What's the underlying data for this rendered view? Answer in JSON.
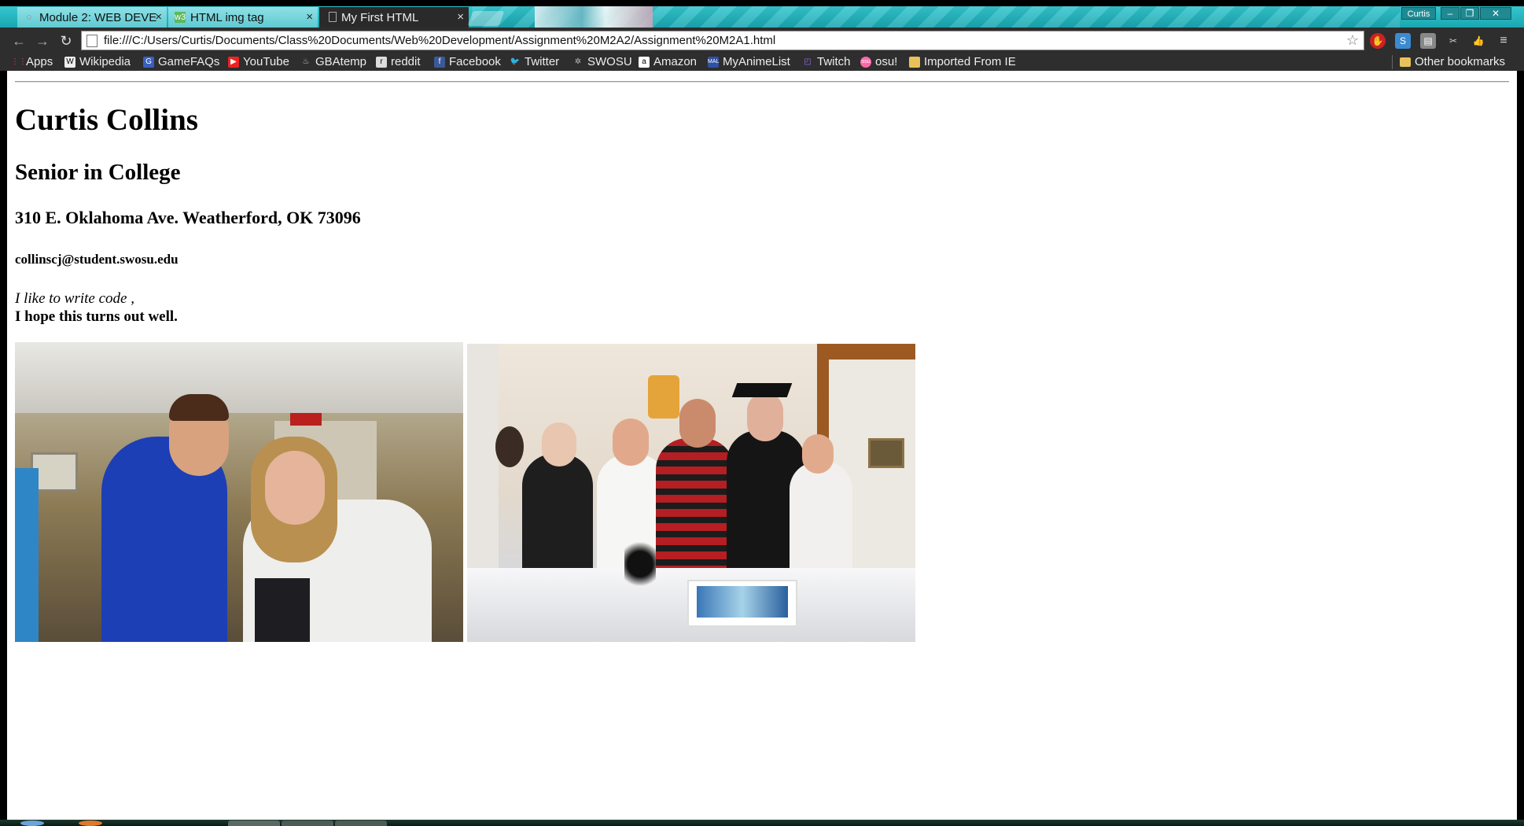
{
  "tabs": [
    {
      "label": "Module 2: WEB DEVE",
      "state": "inactive",
      "icon": "spinner-icon"
    },
    {
      "label": "HTML img tag",
      "state": "inactive",
      "icon": "w3schools-icon"
    },
    {
      "label": "My First HTML",
      "state": "active",
      "icon": "page-icon"
    }
  ],
  "window": {
    "user": "Curtis"
  },
  "toolbar": {
    "url": "file:///C:/Users/Curtis/Documents/Class%20Documents/Web%20Development/Assignment%20M2A2/Assignment%20M2A1.html"
  },
  "bookmarks": {
    "items": [
      "Apps",
      "Wikipedia",
      "GameFAQs",
      "YouTube",
      "GBAtemp",
      "reddit",
      "Facebook",
      "Twitter",
      "SWOSU",
      "Amazon",
      "MyAnimeList",
      "Twitch",
      "osu!",
      "Imported From IE"
    ],
    "other": "Other bookmarks"
  },
  "page": {
    "name": "Curtis Collins",
    "title": "Senior in College",
    "address": "310 E. Oklahoma Ave. Weatherford, OK 73096",
    "email": "collinscj@student.swosu.edu",
    "line1": "I like to write code ,",
    "line2": "I hope this turns out well."
  },
  "colors": {
    "tabstrip": "#1aa6b0",
    "toolbar": "#2e2e2e",
    "page": "#ffffff"
  }
}
